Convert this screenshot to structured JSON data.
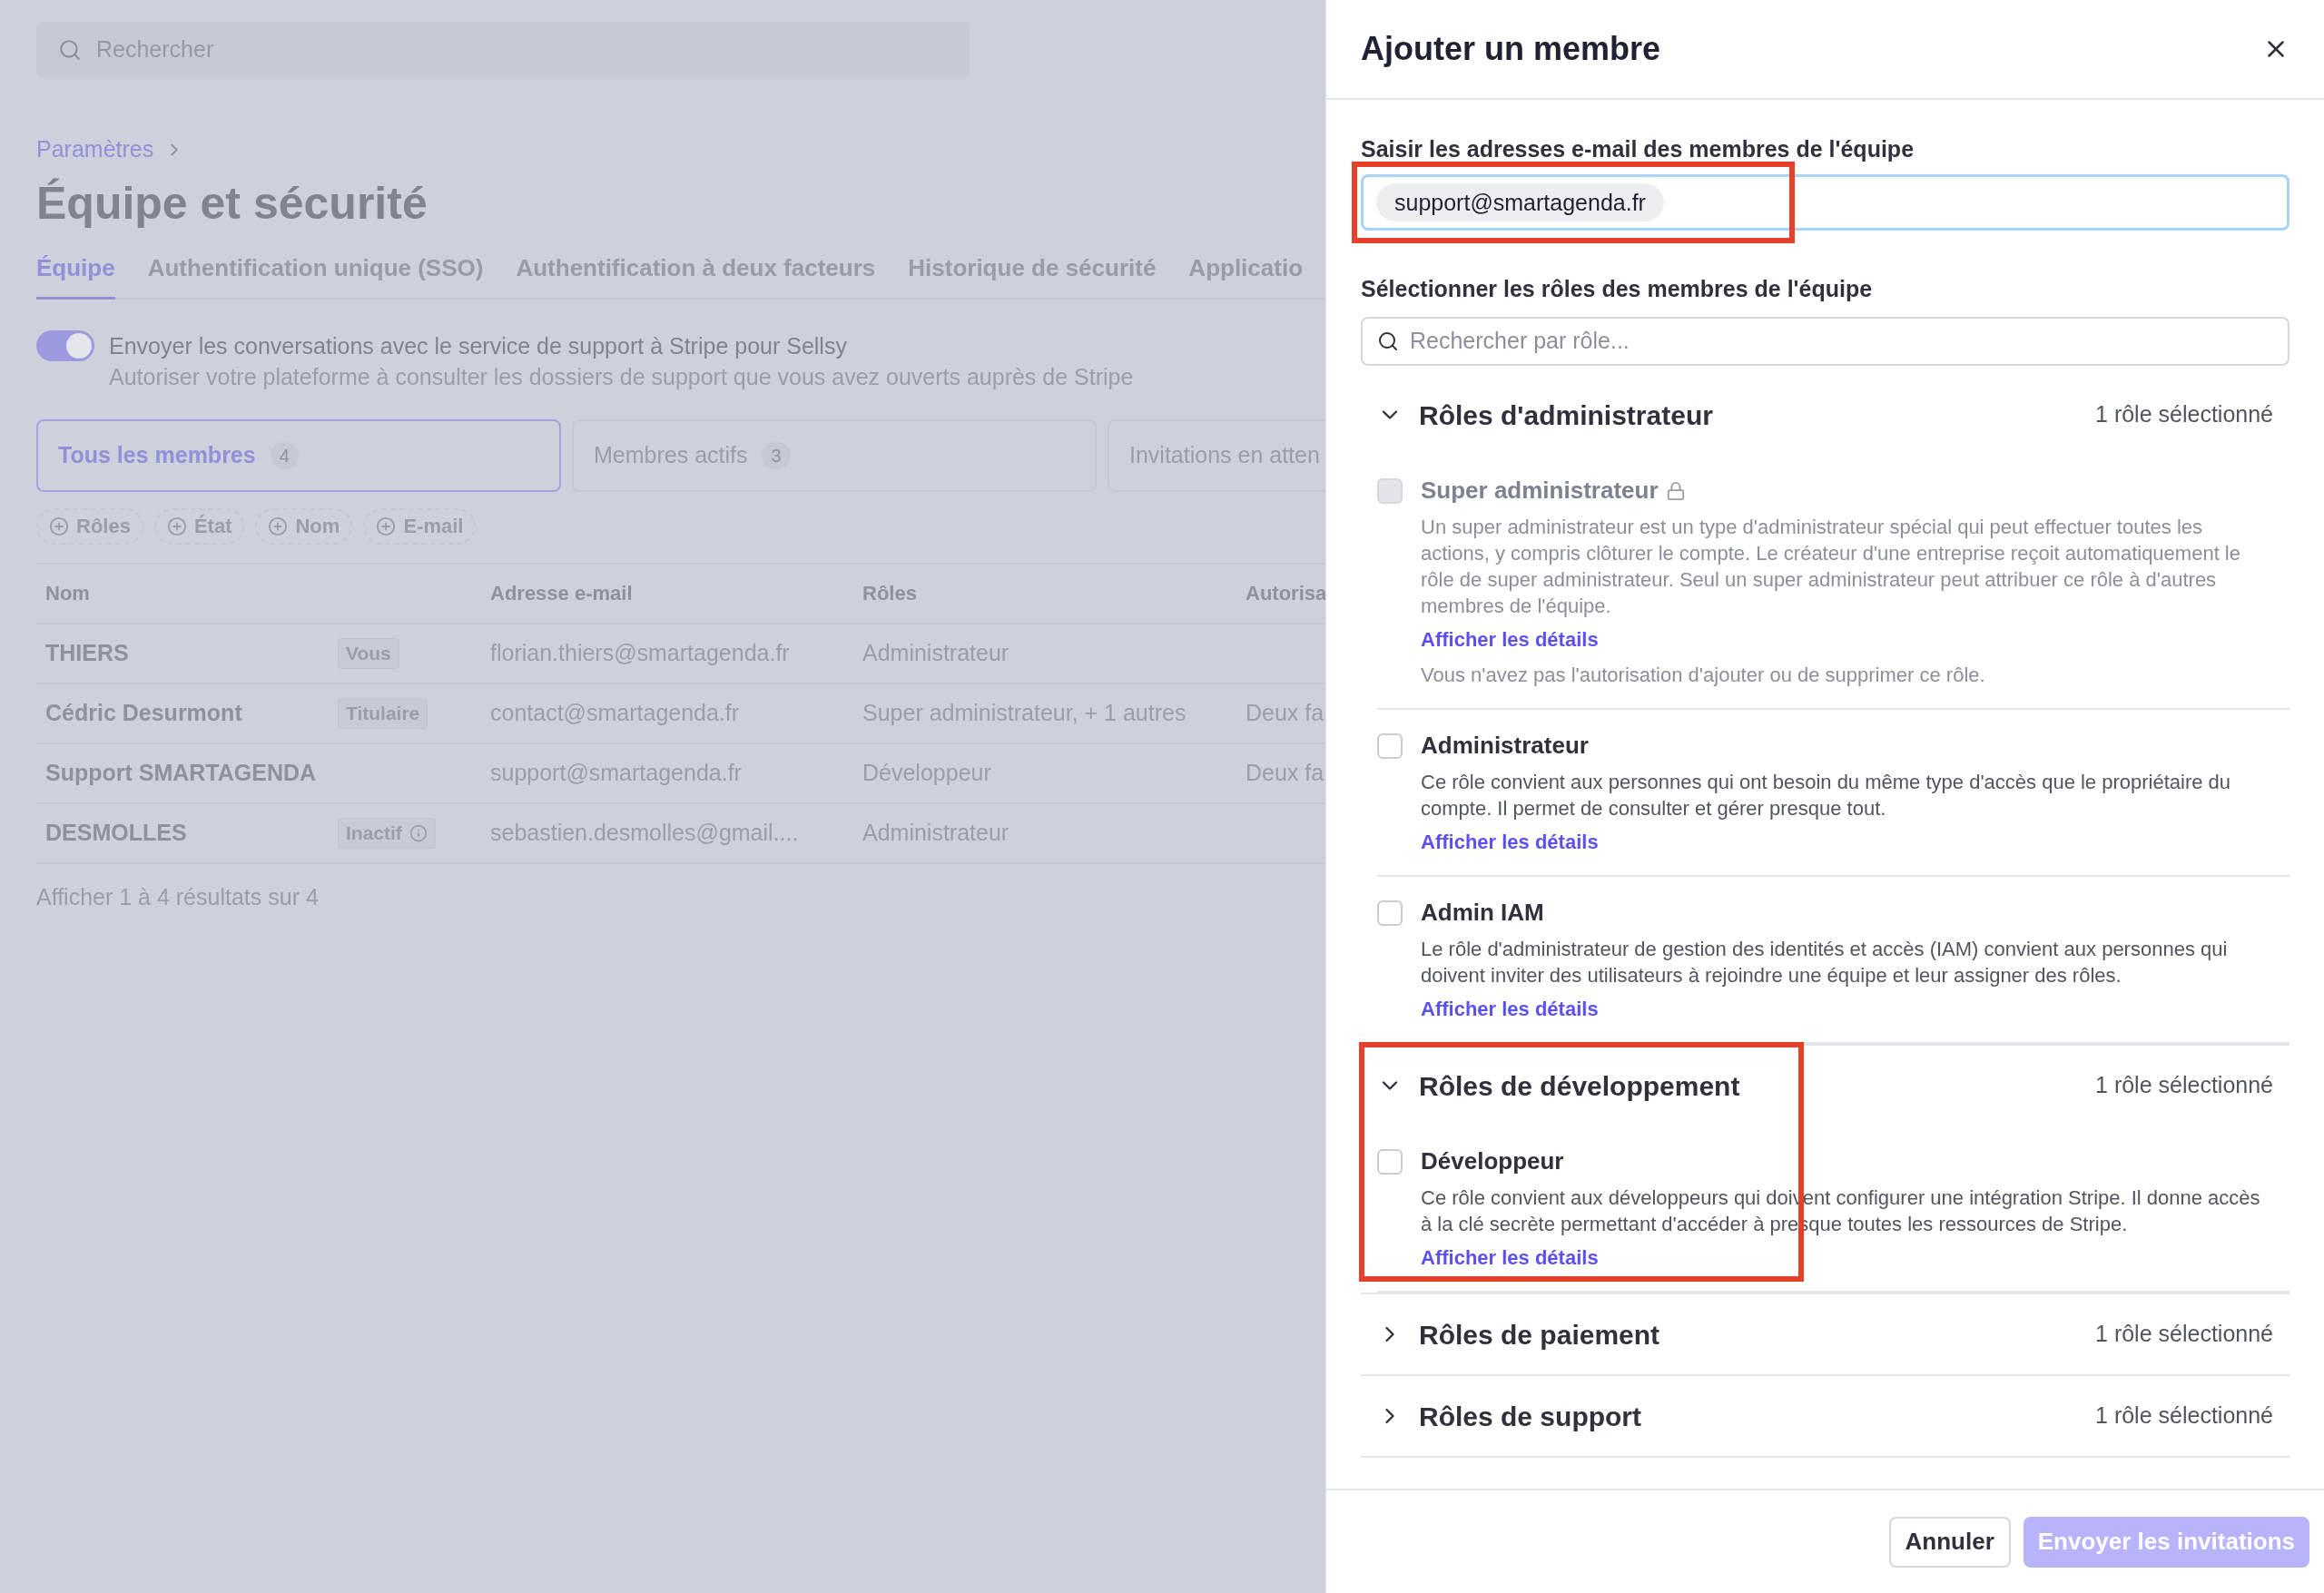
{
  "background_page": {
    "search": {
      "placeholder": "Rechercher"
    },
    "breadcrumb": "Paramètres",
    "title": "Équipe et sécurité",
    "tabs": [
      {
        "label": "Équipe",
        "selected": true
      },
      {
        "label": "Authentification unique (SSO)",
        "selected": false
      },
      {
        "label": "Authentification à deux facteurs",
        "selected": false
      },
      {
        "label": "Historique de sécurité",
        "selected": false
      },
      {
        "label": "Applicatio",
        "selected": false
      }
    ],
    "support_toggle": {
      "on": true,
      "label": "Envoyer les conversations avec le service de support à Stripe pour Sellsy",
      "description": "Autoriser votre plateforme à consulter les dossiers de support que vous avez ouverts auprès de Stripe"
    },
    "member_filters": [
      {
        "label": "Tous les membres",
        "count": "4",
        "selected": true
      },
      {
        "label": "Membres actifs",
        "count": "3",
        "selected": false
      },
      {
        "label": "Invitations en atten",
        "selected": false
      }
    ],
    "filter_chips": [
      "Rôles",
      "État",
      "Nom",
      "E-mail"
    ],
    "table": {
      "columns": [
        "Nom",
        "",
        "Adresse e-mail",
        "Rôles",
        "Autorisa"
      ],
      "rows": [
        {
          "name": "THIERS",
          "badge": "Vous",
          "email": "florian.thiers@smartagenda.fr",
          "roles": "Administrateur"
        },
        {
          "name": "Cédric Desurmont",
          "badge": "Titulaire",
          "email": "contact@smartagenda.fr",
          "roles": "Super administrateur, + 1 autres",
          "column_5": "Deux fa"
        },
        {
          "name": "Support SMARTAGENDA",
          "email": "support@smartagenda.fr",
          "roles": "Développeur",
          "column_5": "Deux fa"
        },
        {
          "name": "DESMOLLES",
          "badge": "Inactif",
          "badge_info": true,
          "email": "sebastien.desmolles@gmail....",
          "roles": "Administrateur"
        }
      ]
    },
    "results": "Afficher 1 à 4 résultats sur 4"
  },
  "dialog": {
    "title": "Ajouter un membre",
    "email_label": "Saisir les adresses e-mail des membres de l'équipe",
    "email_chips": [
      "support@smartagenda.fr"
    ],
    "email_highlighted": true,
    "roles_label": "Sélectionner les rôles des membres de l'équipe",
    "role_search": {
      "placeholder": "Rechercher par rôle..."
    },
    "sections": [
      {
        "title": "Rôles d'administrateur",
        "summary": "1 rôle sélectionné",
        "expanded": true,
        "roles": [
          {
            "name": "Super administrateur",
            "locked": true,
            "checked": false,
            "disabled": true,
            "description": "Un super administrateur est un type d'administrateur spécial qui peut effectuer toutes les actions, y compris clôturer le compte. Le créateur d'une entreprise reçoit automatiquement le rôle de super administrateur. Seul un super administrateur peut attribuer ce rôle à d'autres membres de l'équipe.",
            "link": "Afficher les détails",
            "note": "Vous n'avez pas l'autorisation d'ajouter ou de supprimer ce rôle."
          },
          {
            "name": "Administrateur",
            "locked": false,
            "checked": false,
            "disabled": false,
            "description": "Ce rôle convient aux personnes qui ont besoin du même type d'accès que le propriétaire du compte. Il permet de consulter et gérer presque tout.",
            "link": "Afficher les détails"
          },
          {
            "name": "Admin IAM",
            "locked": false,
            "checked": false,
            "disabled": false,
            "description": "Le rôle d'administrateur de gestion des identités et accès (IAM) convient aux personnes qui doivent inviter des utilisateurs à rejoindre une équipe et leur assigner des rôles.",
            "link": "Afficher les détails"
          }
        ]
      },
      {
        "title": "Rôles de développement",
        "summary": "1 rôle sélectionné",
        "expanded": true,
        "highlighted": true,
        "roles": [
          {
            "name": "Développeur",
            "locked": false,
            "checked": false,
            "disabled": false,
            "description": "Ce rôle convient aux développeurs qui doivent configurer une intégration Stripe. Il donne accès à la clé secrète permettant d'accéder à presque toutes les ressources de Stripe.",
            "link": "Afficher les détails"
          }
        ]
      },
      {
        "title": "Rôles de paiement",
        "summary": "1 rôle sélectionné",
        "expanded": false
      },
      {
        "title": "Rôles de support",
        "summary": "1 rôle sélectionné",
        "expanded": false
      }
    ],
    "buttons": [
      {
        "label": "Annuler",
        "kind": "secondary"
      },
      {
        "label": "Envoyer les invitations",
        "kind": "primary",
        "disabled": true
      }
    ]
  }
}
